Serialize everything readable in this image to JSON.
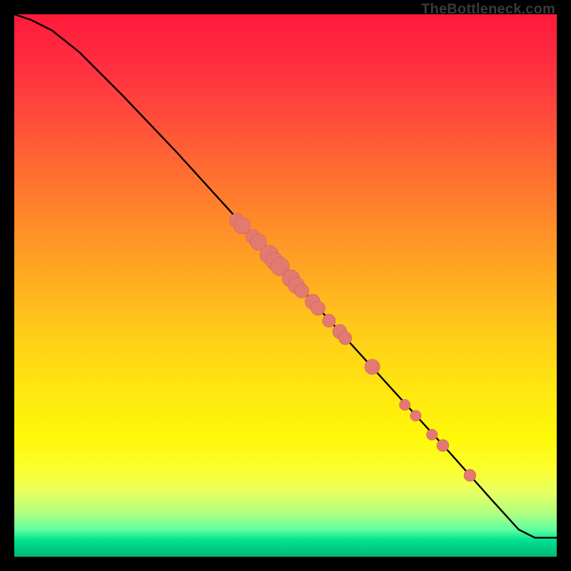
{
  "watermark": "TheBottleneck.com",
  "colors": {
    "background": "#000000",
    "line": "#000000",
    "dot_fill": "#e27a72",
    "dot_stroke": "#d06058"
  },
  "chart_data": {
    "type": "line",
    "title": "",
    "xlabel": "",
    "ylabel": "",
    "xlim": [
      0,
      100
    ],
    "ylim": [
      0,
      100
    ],
    "line_series": {
      "name": "curve",
      "x": [
        0,
        3,
        7,
        12,
        20,
        30,
        40,
        50,
        60,
        70,
        80,
        88,
        93,
        96,
        100
      ],
      "y": [
        100,
        99,
        97,
        93,
        85,
        74.5,
        63.5,
        52.5,
        41.5,
        30.5,
        19.5,
        10.5,
        5,
        3.5,
        3.5
      ]
    },
    "scatter_series": {
      "name": "markers",
      "points": [
        {
          "x": 41,
          "y": 62,
          "r": 1.3
        },
        {
          "x": 42,
          "y": 61,
          "r": 1.5
        },
        {
          "x": 44,
          "y": 59,
          "r": 1.3
        },
        {
          "x": 45,
          "y": 58,
          "r": 1.5
        },
        {
          "x": 47,
          "y": 55.7,
          "r": 1.7
        },
        {
          "x": 48,
          "y": 54.5,
          "r": 1.6
        },
        {
          "x": 49,
          "y": 53.5,
          "r": 1.7
        },
        {
          "x": 51,
          "y": 51.3,
          "r": 1.6
        },
        {
          "x": 52,
          "y": 50,
          "r": 1.5
        },
        {
          "x": 53,
          "y": 49,
          "r": 1.3
        },
        {
          "x": 55,
          "y": 47,
          "r": 1.4
        },
        {
          "x": 56,
          "y": 45.8,
          "r": 1.3
        },
        {
          "x": 58,
          "y": 43.5,
          "r": 1.2
        },
        {
          "x": 60,
          "y": 41.5,
          "r": 1.3
        },
        {
          "x": 61,
          "y": 40.3,
          "r": 1.2
        },
        {
          "x": 66,
          "y": 35,
          "r": 1.4
        },
        {
          "x": 72,
          "y": 28,
          "r": 1.0
        },
        {
          "x": 74,
          "y": 26,
          "r": 1.0
        },
        {
          "x": 77,
          "y": 22.5,
          "r": 1.0
        },
        {
          "x": 79,
          "y": 20.5,
          "r": 1.1
        },
        {
          "x": 84,
          "y": 15,
          "r": 1.1
        }
      ]
    }
  }
}
